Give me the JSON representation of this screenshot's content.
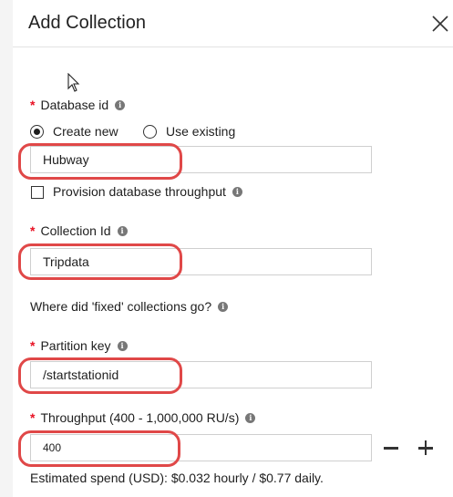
{
  "panel": {
    "title": "Add Collection"
  },
  "database": {
    "label": "Database id",
    "required_mark": "*",
    "options": [
      "Create new",
      "Use existing"
    ],
    "selected": "Create new",
    "value": "Hubway",
    "throughput_checkbox_label": "Provision database throughput",
    "throughput_checked": false
  },
  "collection": {
    "label": "Collection Id",
    "required_mark": "*",
    "value": "Tripdata",
    "fixed_link": "Where did 'fixed' collections go?"
  },
  "partition": {
    "label": "Partition key",
    "required_mark": "*",
    "value": "/startstationid"
  },
  "throughput": {
    "label": "Throughput (400 - 1,000,000 RU/s)",
    "required_mark": "*",
    "value": "400",
    "estimate": "Estimated spend (USD): $0.032 hourly / $0.77 daily."
  },
  "colors": {
    "highlight": "#e04848",
    "required": "#e81123"
  },
  "icons": [
    "close-icon",
    "info-icon",
    "minus-icon",
    "plus-icon",
    "cursor-icon"
  ]
}
